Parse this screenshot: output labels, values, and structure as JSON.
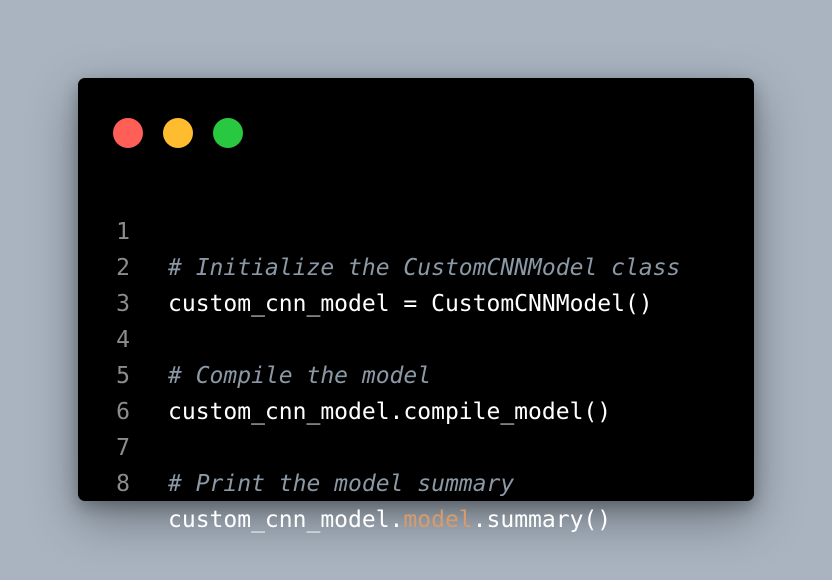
{
  "window": {
    "controls": [
      {
        "name": "close",
        "color": "#ff5f57"
      },
      {
        "name": "minimize",
        "color": "#febc2e"
      },
      {
        "name": "maximize",
        "color": "#28c840"
      }
    ]
  },
  "code": {
    "lines": [
      {
        "number": "1",
        "text": "# Initialize the CustomCNNModel class",
        "type": "comment"
      },
      {
        "number": "2",
        "text": "custom_cnn_model = CustomCNNModel()",
        "type": "code"
      },
      {
        "number": "3",
        "text": "",
        "type": "blank"
      },
      {
        "number": "4",
        "text": "# Compile the model",
        "type": "comment"
      },
      {
        "number": "5",
        "text": "custom_cnn_model.compile_model()",
        "type": "code"
      },
      {
        "number": "6",
        "text": "",
        "type": "blank"
      },
      {
        "number": "7",
        "text": "# Print the model summary",
        "type": "comment"
      },
      {
        "number": "8",
        "pre": "custom_cnn_model.",
        "attr": "model",
        "post": ".summary()",
        "type": "code"
      }
    ]
  },
  "colors": {
    "background": "#a9b4c0",
    "editor": "#000000",
    "comment": "#8b98a5",
    "code": "#ffffff",
    "line_number": "#8c8c8c",
    "attribute": "#d89b6a"
  }
}
